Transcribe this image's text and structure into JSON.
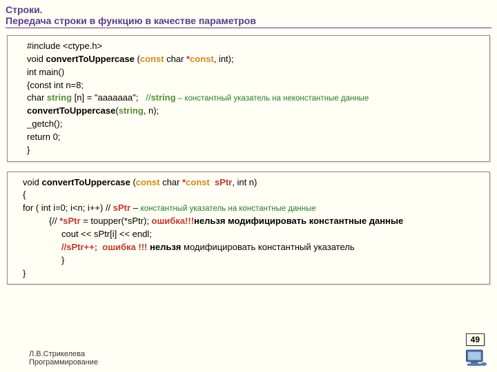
{
  "title": {
    "line1": "Строки.",
    "line2": " Передача строки в функцию в качестве параметров"
  },
  "box1": {
    "l1_include": "#include <ctype.h>",
    "l2_void": "void ",
    "l2_func": "convertToUppercase",
    "l2_open": " (",
    "l2_const1": "const",
    "l2_mid": " char ",
    "l2_star": "*",
    "l2_const2": "const",
    "l2_end": ", int);",
    "l3": "int main()",
    "l4": "{const int n=8;",
    "l5a": "char ",
    "l5_string": "string",
    "l5b": " [n] = \"ааааааа\";   ",
    "l5_c1": "//",
    "l5_c2": "string",
    "l5_c3": " – константный указатель на неконстантные данные",
    "l6_func": "convertToUppercase",
    "l6_open": "(",
    "l6_string": "string",
    "l6_end": ", n);",
    "l7": "_getch();",
    "l8": "return 0;",
    "l9": "}"
  },
  "box2": {
    "l1_void": "void ",
    "l1_func": "convertToUppercase",
    "l1_open": " (",
    "l1_const1": "const",
    "l1_mid": " char ",
    "l1_star": "*",
    "l1_const2": "const  ",
    "l1_sptr": "sPtr",
    "l1_end": ", int n)",
    "l2": "{",
    "l3a": "for ( int i=0; i<n; i++) // ",
    "l3_sptr": "sPtr",
    "l3b": " – ",
    "l3_c": "константный указатель на константные данные",
    "l4a": "{// ",
    "l4_sptr": "*sPtr",
    "l4b": " = toupper(*sPtr); ",
    "l4_err": "ошибка!!!",
    "l4_txt": "нельзя модифицировать константные данные",
    "l5": "cout << sPtr[i] << endl;",
    "l6_sptr": "//sPtr++;",
    "l6_err": "  ошибка !!! ",
    "l6_txt": "нельзя",
    "l6_txt2": " модифицировать константный указатель",
    "l7": "}",
    "l8": "}"
  },
  "footer": {
    "l1": "Л.В.Стрикелева",
    "l2": "Программирование"
  },
  "pagenum": "49"
}
